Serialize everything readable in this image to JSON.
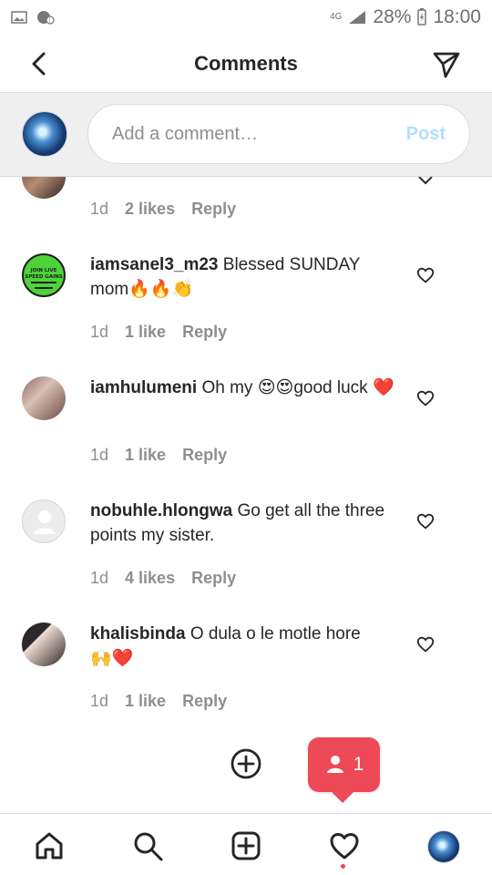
{
  "status": {
    "network": "4G",
    "battery": "28%",
    "time": "18:00",
    "icons": [
      "image-icon",
      "alert-icon",
      "signal-icon",
      "battery-icon"
    ]
  },
  "header": {
    "title": "Comments",
    "back_icon": "back-icon",
    "send_icon": "send-icon"
  },
  "composer": {
    "placeholder": "Add a comment…",
    "post": "Post"
  },
  "previous": {
    "meta": [
      "1d",
      "2 likes",
      "Reply"
    ]
  },
  "comments": [
    {
      "user": "iamsanel3_m23",
      "text": "Blessed SUNDAY mom",
      "emoji": "🔥🔥👏",
      "meta": [
        "1d",
        "1 like",
        "Reply"
      ],
      "avatar": "avatar-green"
    },
    {
      "user": "iamhulumeni",
      "text": "Oh my",
      "emoji1": "😍😍",
      "text2": "good luck",
      "emoji2": "❤️",
      "meta": [
        "1d",
        "1 like",
        "Reply"
      ],
      "avatar": "avatar-photo"
    },
    {
      "user": "nobuhle.hlongwa",
      "text": "Go get all the three points my sister.",
      "meta": [
        "1d",
        "4 likes",
        "Reply"
      ],
      "avatar": "avatar-placeholder"
    },
    {
      "user": "khalisbinda",
      "text": "O dula o le motle hore",
      "emoji": "🙌❤️",
      "meta": [
        "1d",
        "1 like",
        "Reply"
      ],
      "avatar": "avatar-photo"
    }
  ],
  "notification": {
    "count": "1"
  },
  "nav": {
    "items": [
      "home-icon",
      "search-icon",
      "add-icon",
      "activity-icon",
      "profile-icon"
    ]
  }
}
